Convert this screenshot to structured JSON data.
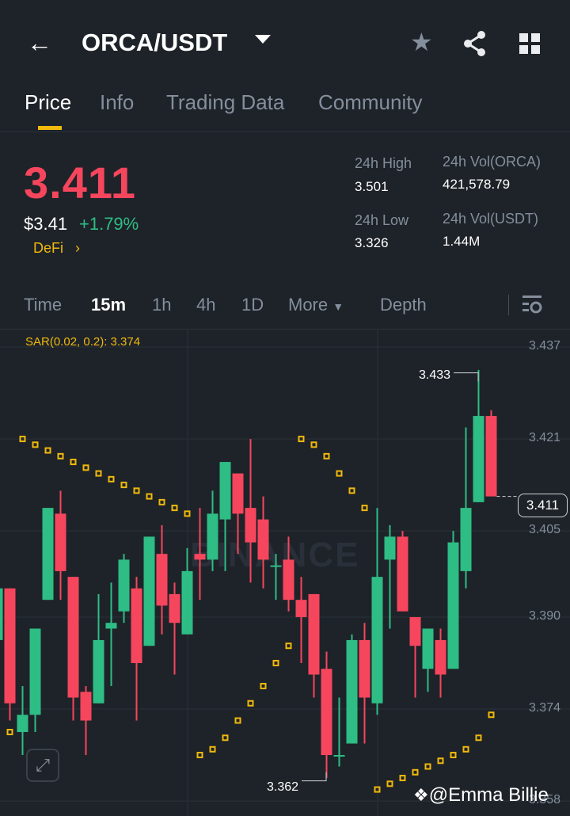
{
  "header": {
    "title": "ORCA/USDT",
    "icons": [
      "back-arrow-icon",
      "caret-down-icon",
      "star-icon",
      "share-icon",
      "grid-icon"
    ]
  },
  "tabs": [
    {
      "label": "Price",
      "active": true
    },
    {
      "label": "Info"
    },
    {
      "label": "Trading Data"
    },
    {
      "label": "Community"
    }
  ],
  "ticker": {
    "last": "3.411",
    "usd": "$3.41",
    "change": "+1.79%",
    "category": "DeFi",
    "category_chevron": "›",
    "stats": {
      "high_label": "24h High",
      "high": "3.501",
      "low_label": "24h Low",
      "low": "3.326",
      "vol_base_label": "24h Vol(ORCA)",
      "vol_base": "421,578.79",
      "vol_quote_label": "24h Vol(USDT)",
      "vol_quote": "1.44M"
    }
  },
  "timeframes": {
    "items": [
      "Time",
      "15m",
      "1h",
      "4h",
      "1D"
    ],
    "active": "15m",
    "more": "More",
    "depth": "Depth"
  },
  "chart": {
    "indicator": "SAR(0.02, 0.2): 3.374",
    "watermark": "BINANCE",
    "credit": "@Emma Billie",
    "current_price": "3.411",
    "high_marker": "3.433",
    "low_marker": "3.362"
  },
  "colors": {
    "up": "#2ebd85",
    "down": "#f6465d",
    "accent": "#f0b90b",
    "bg": "#1e2329"
  },
  "chart_data": {
    "type": "candlestick",
    "interval": "15m",
    "ylim": [
      3.355,
      3.44
    ],
    "y_ticks": [
      "3.437",
      "3.421",
      "3.405",
      "3.390",
      "3.374",
      "3.358"
    ],
    "ohlc": [
      [
        3.386,
        3.395,
        3.386,
        3.395
      ],
      [
        3.395,
        3.395,
        3.372,
        3.375
      ],
      [
        3.37,
        3.378,
        3.366,
        3.373
      ],
      [
        3.373,
        3.388,
        3.37,
        3.388
      ],
      [
        3.393,
        3.409,
        3.393,
        3.409
      ],
      [
        3.408,
        3.412,
        3.393,
        3.398
      ],
      [
        3.397,
        3.397,
        3.372,
        3.376
      ],
      [
        3.377,
        3.378,
        3.366,
        3.372
      ],
      [
        3.375,
        3.394,
        3.375,
        3.386
      ],
      [
        3.388,
        3.396,
        3.378,
        3.389
      ],
      [
        3.391,
        3.401,
        3.389,
        3.4
      ],
      [
        3.395,
        3.397,
        3.372,
        3.382
      ],
      [
        3.385,
        3.404,
        3.385,
        3.404
      ],
      [
        3.401,
        3.406,
        3.387,
        3.392
      ],
      [
        3.394,
        3.396,
        3.38,
        3.389
      ],
      [
        3.387,
        3.402,
        3.387,
        3.398
      ],
      [
        3.401,
        3.409,
        3.393,
        3.4
      ],
      [
        3.4,
        3.412,
        3.398,
        3.408
      ],
      [
        3.407,
        3.417,
        3.398,
        3.417
      ],
      [
        3.415,
        3.415,
        3.401,
        3.408
      ],
      [
        3.409,
        3.421,
        3.396,
        3.403
      ],
      [
        3.407,
        3.411,
        3.395,
        3.4
      ],
      [
        3.399,
        3.401,
        3.393,
        3.399
      ],
      [
        3.4,
        3.404,
        3.391,
        3.393
      ],
      [
        3.393,
        3.397,
        3.382,
        3.39
      ],
      [
        3.394,
        3.394,
        3.376,
        3.38
      ],
      [
        3.381,
        3.384,
        3.362,
        3.366
      ],
      [
        3.366,
        3.376,
        3.364,
        3.366
      ],
      [
        3.368,
        3.387,
        3.368,
        3.386
      ],
      [
        3.386,
        3.389,
        3.368,
        3.376
      ],
      [
        3.375,
        3.409,
        3.373,
        3.397
      ],
      [
        3.4,
        3.406,
        3.388,
        3.404
      ],
      [
        3.404,
        3.405,
        3.391,
        3.391
      ],
      [
        3.39,
        3.39,
        3.376,
        3.385
      ],
      [
        3.381,
        3.388,
        3.377,
        3.388
      ],
      [
        3.386,
        3.388,
        3.376,
        3.38
      ],
      [
        3.381,
        3.405,
        3.381,
        3.403
      ],
      [
        3.398,
        3.423,
        3.395,
        3.409
      ],
      [
        3.41,
        3.433,
        3.41,
        3.425
      ],
      [
        3.425,
        3.426,
        3.411,
        3.411
      ]
    ],
    "sar": [
      null,
      3.37,
      3.421,
      3.42,
      3.419,
      3.418,
      3.417,
      3.416,
      3.415,
      3.414,
      3.413,
      3.412,
      3.411,
      3.41,
      3.409,
      3.408,
      3.366,
      3.367,
      3.369,
      3.372,
      3.375,
      3.378,
      3.382,
      3.385,
      3.421,
      3.42,
      3.418,
      3.415,
      3.412,
      3.409,
      3.36,
      3.361,
      3.362,
      3.363,
      3.364,
      3.365,
      3.366,
      3.367,
      3.369,
      3.373
    ]
  }
}
